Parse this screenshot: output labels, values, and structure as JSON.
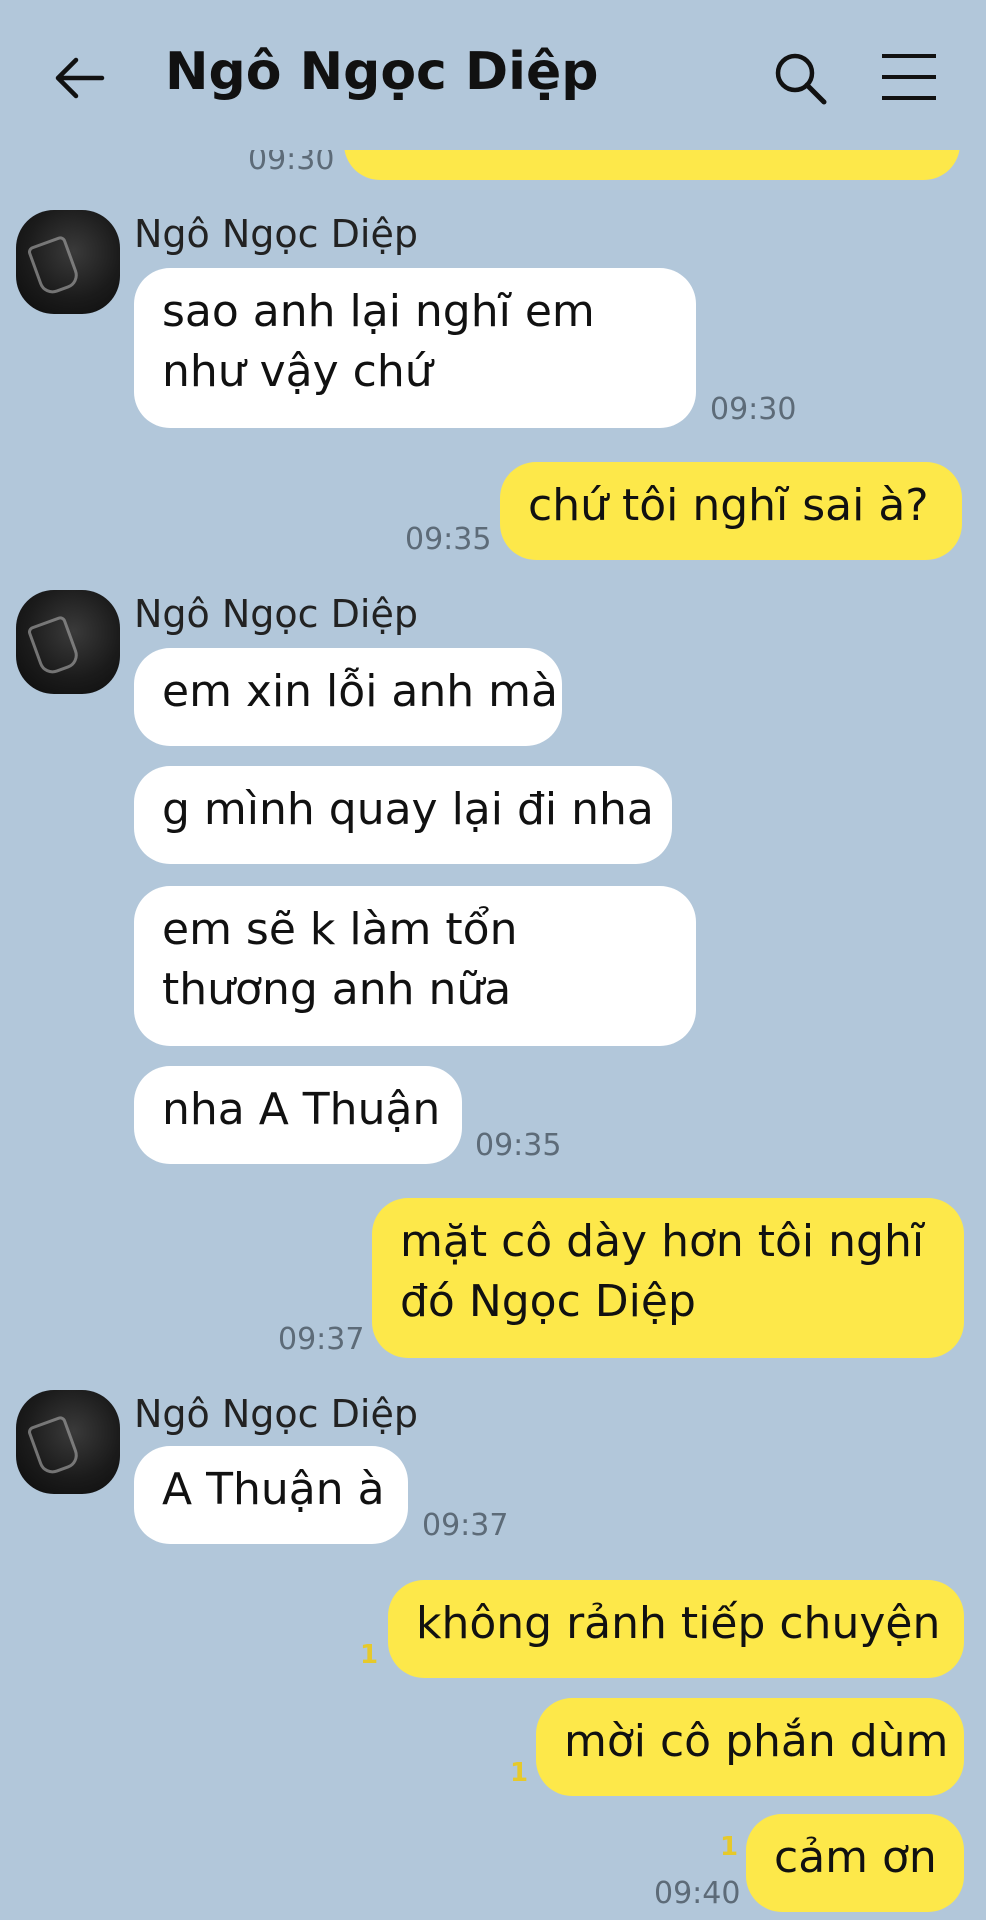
{
  "header": {
    "title": "Ngô Ngọc Diệp",
    "icons": [
      "back-arrow-icon",
      "search-icon",
      "menu-icon"
    ]
  },
  "colors": {
    "background": "#b2c7da",
    "incoming_bubble": "#ffffff",
    "outgoing_bubble": "#fde84a",
    "unread_count": "#e6c92a"
  },
  "messages": {
    "top_time": "09:30",
    "group1": {
      "sender": "Ngô Ngọc Diệp",
      "text": "sao anh lại nghĩ em như vậy chứ",
      "time": "09:30"
    },
    "out1": {
      "text": "chứ tôi nghĩ sai à?",
      "time": "09:35"
    },
    "group2": {
      "sender": "Ngô Ngọc Diệp",
      "m1": "em xin lỗi anh mà",
      "m2": "g mình quay lại đi nha",
      "m3": "em sẽ k làm tổn thương anh nữa",
      "m4": "nha A Thuận",
      "time": "09:35"
    },
    "out2": {
      "text": "mặt cô dày hơn tôi nghĩ đó Ngọc Diệp",
      "time": "09:37"
    },
    "group3": {
      "sender": "Ngô Ngọc Diệp",
      "text": "A Thuận à",
      "time": "09:37"
    },
    "out3": {
      "m1": "không rảnh tiếp chuyện",
      "m1_unread": "1",
      "m2": "mời cô phắn dùm",
      "m2_unread": "1",
      "m3": "cảm ơn",
      "m3_unread": "1",
      "time": "09:40"
    }
  }
}
